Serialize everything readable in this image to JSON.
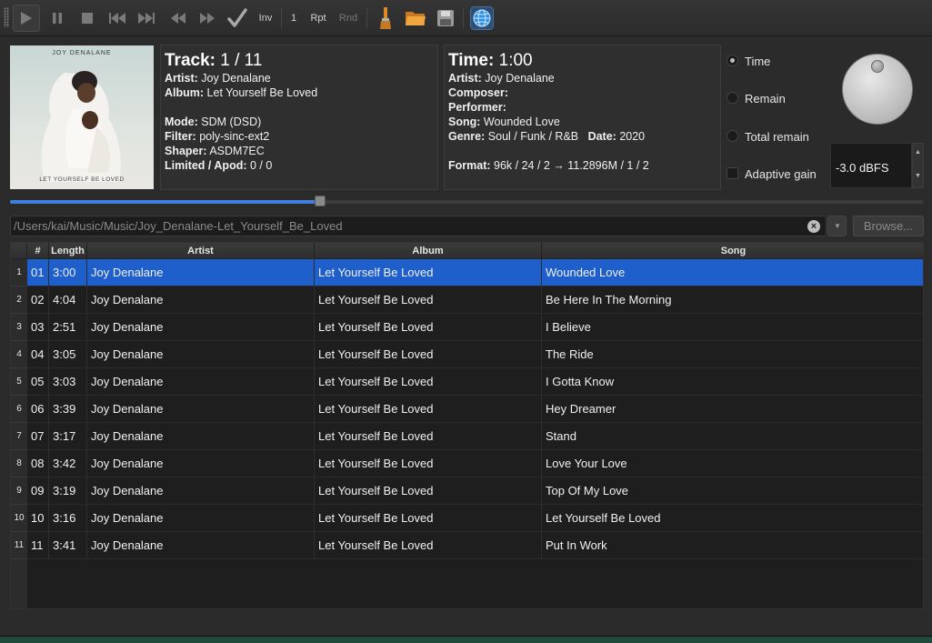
{
  "toolbar": {
    "inv_label": "Inv",
    "repeat_count": "1",
    "rpt_label": "Rpt",
    "rnd_label": "Rnd"
  },
  "cover": {
    "artist_text": "JOY DENALANE",
    "album_text": "LET YOURSELF BE LOVED"
  },
  "track_panel": {
    "track_label": "Track:",
    "track_value": "1 / 11",
    "artist_label": "Artist:",
    "artist_value": "Joy Denalane",
    "album_label": "Album:",
    "album_value": "Let Yourself Be Loved",
    "mode_label": "Mode:",
    "mode_value": "SDM (DSD)",
    "filter_label": "Filter:",
    "filter_value": "poly-sinc-ext2",
    "shaper_label": "Shaper:",
    "shaper_value": "ASDM7EC",
    "limited_label": "Limited / Apod:",
    "limited_value": "0 / 0"
  },
  "time_panel": {
    "time_label": "Time:",
    "time_value": "1:00",
    "artist_label": "Artist:",
    "artist_value": "Joy Denalane",
    "composer_label": "Composer:",
    "composer_value": "",
    "performer_label": "Performer:",
    "performer_value": "",
    "song_label": "Song:",
    "song_value": "Wounded Love",
    "genre_label": "Genre:",
    "genre_value": "Soul / Funk / R&B",
    "date_label": "Date:",
    "date_value": "2020",
    "format_label": "Format:",
    "format_value": "96k / 24 / 2 → 11.2896M / 1 / 2"
  },
  "display_options": {
    "time": "Time",
    "remain": "Remain",
    "total_remain": "Total remain",
    "selected": "time",
    "adaptive_gain": "Adaptive gain",
    "adaptive_gain_checked": false
  },
  "volume": {
    "value": "-3.0 dBFS"
  },
  "progress": {
    "fraction": 0.339
  },
  "path": {
    "value": "/Users/kai/Music/Music/Joy_Denalane-Let_Yourself_Be_Loved",
    "browse_label": "Browse..."
  },
  "playlist": {
    "columns": [
      "#",
      "Length",
      "Artist",
      "Album",
      "Song"
    ],
    "selected_index": 0,
    "rows": [
      {
        "n": "1",
        "num": "01",
        "length": "3:00",
        "artist": "Joy Denalane",
        "album": "Let Yourself Be Loved",
        "song": "Wounded Love"
      },
      {
        "n": "2",
        "num": "02",
        "length": "4:04",
        "artist": "Joy Denalane",
        "album": "Let Yourself Be Loved",
        "song": "Be Here In The Morning"
      },
      {
        "n": "3",
        "num": "03",
        "length": "2:51",
        "artist": "Joy Denalane",
        "album": "Let Yourself Be Loved",
        "song": "I Believe"
      },
      {
        "n": "4",
        "num": "04",
        "length": "3:05",
        "artist": "Joy Denalane",
        "album": "Let Yourself Be Loved",
        "song": "The Ride"
      },
      {
        "n": "5",
        "num": "05",
        "length": "3:03",
        "artist": "Joy Denalane",
        "album": "Let Yourself Be Loved",
        "song": "I Gotta Know"
      },
      {
        "n": "6",
        "num": "06",
        "length": "3:39",
        "artist": "Joy Denalane",
        "album": "Let Yourself Be Loved",
        "song": "Hey Dreamer"
      },
      {
        "n": "7",
        "num": "07",
        "length": "3:17",
        "artist": "Joy Denalane",
        "album": "Let Yourself Be Loved",
        "song": "Stand"
      },
      {
        "n": "8",
        "num": "08",
        "length": "3:42",
        "artist": "Joy Denalane",
        "album": "Let Yourself Be Loved",
        "song": "Love Your Love"
      },
      {
        "n": "9",
        "num": "09",
        "length": "3:19",
        "artist": "Joy Denalane",
        "album": "Let Yourself Be Loved",
        "song": "Top Of My Love"
      },
      {
        "n": "10",
        "num": "10",
        "length": "3:16",
        "artist": "Joy Denalane",
        "album": "Let Yourself Be Loved",
        "song": "Let Yourself Be Loved"
      },
      {
        "n": "11",
        "num": "11",
        "length": "3:41",
        "artist": "Joy Denalane",
        "album": "Let Yourself Be Loved",
        "song": "Put In Work"
      }
    ]
  }
}
